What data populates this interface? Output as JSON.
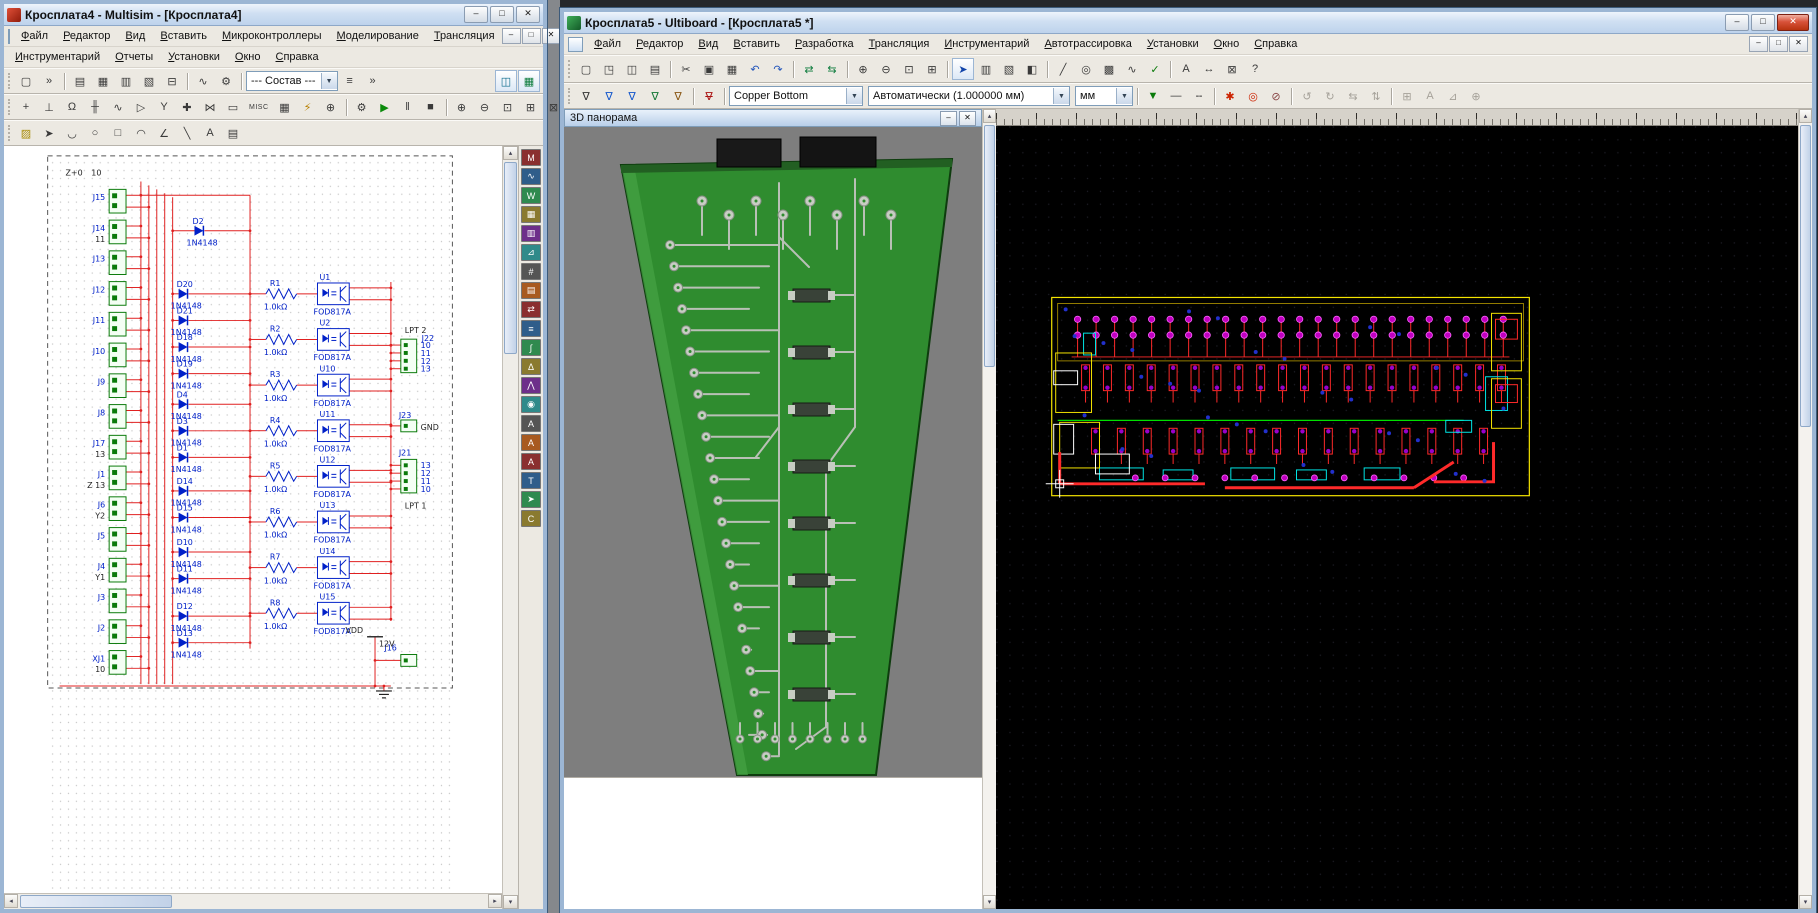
{
  "window_controls": {
    "minimize": "–",
    "maximize": "□",
    "close": "✕"
  },
  "multisim": {
    "title": "Кросплата4 - Multisim - [Кросплата4]",
    "menu_row1": [
      {
        "name": "file",
        "label": "Файл"
      },
      {
        "name": "edit",
        "label": "Редактор"
      },
      {
        "name": "view",
        "label": "Вид"
      },
      {
        "name": "place",
        "label": "Вставить"
      },
      {
        "name": "mcu",
        "label": "Микроконтроллеры"
      },
      {
        "name": "simulate",
        "label": "Моделирование"
      },
      {
        "name": "transfer",
        "label": "Трансляция"
      }
    ],
    "menu_row2": [
      {
        "name": "tools",
        "label": "Инструментарий"
      },
      {
        "name": "reports",
        "label": "Отчеты"
      },
      {
        "name": "options",
        "label": "Установки"
      },
      {
        "name": "window",
        "label": "Окно"
      },
      {
        "name": "help",
        "label": "Справка"
      }
    ],
    "composition_combo": "--- Состав ---",
    "toolbar_main_left": [
      {
        "name": "new-document-icon",
        "g": "▢"
      },
      {
        "name": "toolbar-overflow-icon",
        "g": "»"
      },
      {
        "sep": true
      },
      {
        "name": "component-database-icon",
        "g": "▤"
      },
      {
        "name": "spreadsheet-view-icon",
        "g": "▦"
      },
      {
        "name": "variants-icon",
        "g": "▥"
      },
      {
        "name": "sheet-properties-icon",
        "g": "▧"
      },
      {
        "name": "hierarchy-icon",
        "g": "⊟"
      },
      {
        "sep": true
      },
      {
        "name": "grapher-icon",
        "g": "∿"
      },
      {
        "name": "postprocessor-icon",
        "g": "⚙"
      },
      {
        "sep": true
      }
    ],
    "toolbar_main_right": [
      {
        "name": "list-view-icon",
        "g": "≡"
      },
      {
        "name": "overflow-icon",
        "g": "»"
      }
    ],
    "toolbar_main_far": [
      {
        "name": "capture-view-icon",
        "g": "◫",
        "c": "#0a6a8a",
        "cls": "raised"
      },
      {
        "name": "breadboard-view-icon",
        "g": "▦",
        "c": "#0a7a3a",
        "cls": "raised"
      }
    ],
    "toolbar_components": [
      {
        "name": "place-source-icon",
        "g": "+"
      },
      {
        "name": "place-ground-icon",
        "g": "⊥"
      },
      {
        "name": "place-resistor-icon",
        "g": "Ω"
      },
      {
        "name": "place-capacitor-icon",
        "g": "╫"
      },
      {
        "name": "place-inductor-icon",
        "g": "∿"
      },
      {
        "name": "place-diode-icon",
        "g": "▷"
      },
      {
        "name": "place-transistor-icon",
        "g": "Y"
      },
      {
        "name": "place-analog-icon",
        "g": "✚"
      },
      {
        "name": "place-ttl-icon",
        "g": "⋈"
      },
      {
        "name": "place-cmos-icon",
        "g": "▭"
      },
      {
        "name": "place-misc-icon",
        "g": "MISC",
        "cls": "wide"
      },
      {
        "name": "place-indicator-icon",
        "g": "▦"
      },
      {
        "name": "place-power-icon",
        "g": "⚡",
        "c": "#b88000"
      },
      {
        "name": "place-connector-icon",
        "g": "⊕"
      },
      {
        "sep": true
      },
      {
        "name": "simulation-settings-icon",
        "g": "⚙"
      },
      {
        "name": "run-simulation-icon",
        "g": "▶",
        "c": "#0a8a0a"
      },
      {
        "name": "pause-simulation-icon",
        "g": "‖"
      },
      {
        "name": "stop-simulation-icon",
        "g": "■"
      },
      {
        "sep": true
      },
      {
        "name": "zoom-in-icon",
        "g": "⊕"
      },
      {
        "name": "zoom-out-icon",
        "g": "⊖"
      },
      {
        "name": "zoom-area-icon",
        "g": "⊡"
      },
      {
        "name": "zoom-fit-icon",
        "g": "⊞"
      },
      {
        "name": "zoom-full-icon",
        "g": "⊠"
      }
    ],
    "toolbar_draw": [
      {
        "name": "in-use-list-icon",
        "g": "▨",
        "c": "#a88a00"
      },
      {
        "name": "select-tool-icon",
        "g": "➤"
      },
      {
        "name": "arc-tool-icon",
        "g": "◡"
      },
      {
        "name": "ellipse-tool-icon",
        "g": "○"
      },
      {
        "name": "rectangle-tool-icon",
        "g": "□"
      },
      {
        "name": "arc2-tool-icon",
        "g": "◠"
      },
      {
        "name": "polyline-tool-icon",
        "g": "∠"
      },
      {
        "name": "line-tool-icon",
        "g": "╲"
      },
      {
        "name": "text-tool-icon",
        "g": "A"
      },
      {
        "name": "comment-tool-icon",
        "g": "▤"
      }
    ],
    "instruments": [
      {
        "name": "multimeter-icon",
        "g": "M"
      },
      {
        "name": "function-generator-icon",
        "g": "∿"
      },
      {
        "name": "wattmeter-icon",
        "g": "W"
      },
      {
        "name": "oscilloscope-icon",
        "g": "▦"
      },
      {
        "name": "four-channel-oscilloscope-icon",
        "g": "▥"
      },
      {
        "name": "bode-plotter-icon",
        "g": "⊿"
      },
      {
        "name": "frequency-counter-icon",
        "g": "#"
      },
      {
        "name": "word-generator-icon",
        "g": "▤"
      },
      {
        "name": "logic-converter-icon",
        "g": "⇄"
      },
      {
        "name": "logic-analyzer-icon",
        "g": "≡"
      },
      {
        "name": "iv-analyzer-icon",
        "g": "∫"
      },
      {
        "name": "distortion-analyzer-icon",
        "g": "Δ"
      },
      {
        "name": "spectrum-analyzer-icon",
        "g": "⋀"
      },
      {
        "name": "network-analyzer-icon",
        "g": "◉"
      },
      {
        "name": "agilent-function-generator-icon",
        "g": "A"
      },
      {
        "name": "agilent-multimeter-icon",
        "g": "A"
      },
      {
        "name": "agilent-oscilloscope-icon",
        "g": "A"
      },
      {
        "name": "tektronix-oscilloscope-icon",
        "g": "T"
      },
      {
        "name": "measurement-probe-icon",
        "g": "➤"
      },
      {
        "name": "current-clamp-icon",
        "g": "C"
      }
    ],
    "schematic": {
      "origin_note": {
        "a": "Z+0",
        "b": "10"
      },
      "connectors": [
        {
          "label": "J15"
        },
        {
          "label": "J14",
          "sub": "11"
        },
        {
          "label": "J13"
        },
        {
          "label": "J12"
        },
        {
          "label": "J11"
        },
        {
          "label": "J10"
        },
        {
          "label": "J9"
        },
        {
          "label": "J8"
        },
        {
          "label": "J17",
          "sub": "13"
        },
        {
          "label": "J1",
          "sub": "Z 13"
        },
        {
          "label": "J6",
          "sub": "Y2"
        },
        {
          "label": "J5"
        },
        {
          "label": "J4",
          "sub": "Y1"
        },
        {
          "label": "J3"
        },
        {
          "label": "J2"
        },
        {
          "label": "XJ1",
          "sub": "10"
        }
      ],
      "diode_part": "1N4148",
      "diodes": [
        "D2",
        "D20",
        "D21",
        "D18",
        "D19",
        "D4",
        "D3",
        "D1",
        "D14",
        "D15",
        "D10",
        "D11",
        "D12",
        "D13"
      ],
      "resistor_value": "1.0kΩ",
      "opto_part": "FOD817A",
      "opto_rows": [
        {
          "r": "R1",
          "u": "U1"
        },
        {
          "r": "R2",
          "u": "U2"
        },
        {
          "r": "R3",
          "u": "U10"
        },
        {
          "r": "R4",
          "u": "U11"
        },
        {
          "r": "R5",
          "u": "U12"
        },
        {
          "r": "R6",
          "u": "U13"
        },
        {
          "r": "R7",
          "u": "U14"
        },
        {
          "r": "R8",
          "u": "U15"
        }
      ],
      "lpt2": {
        "label": "LPT 2",
        "conn": "J22",
        "pins": [
          "10",
          "11",
          "12",
          "13"
        ]
      },
      "gnd": {
        "conn": "J23",
        "label": "GND"
      },
      "lpt1": {
        "label": "LPT 1",
        "conn": "J21",
        "pins": [
          "13",
          "12",
          "11",
          "10"
        ]
      },
      "bottom_conn": "J16",
      "power": {
        "label": "VDD",
        "value": "12V"
      }
    }
  },
  "ultiboard": {
    "title": "Кросплата5 - Ultiboard - [Кросплата5 *]",
    "menu": [
      {
        "name": "file",
        "label": "Файл"
      },
      {
        "name": "edit",
        "label": "Редактор"
      },
      {
        "name": "view",
        "label": "Вид"
      },
      {
        "name": "place",
        "label": "Вставить"
      },
      {
        "name": "design",
        "label": "Разработка"
      },
      {
        "name": "transfer",
        "label": "Трансляция"
      },
      {
        "name": "tools",
        "label": "Инструментарий"
      },
      {
        "name": "autoroute",
        "label": "Автотрассировка"
      },
      {
        "name": "options",
        "label": "Установки"
      },
      {
        "name": "window",
        "label": "Окно"
      },
      {
        "name": "help",
        "label": "Справка"
      }
    ],
    "panel_3d_title": "3D панорама",
    "layer_combo": "Copper Bottom",
    "grid_combo": "Автоматически (1.000000 мм)",
    "units_combo": "мм",
    "toolbar_std": [
      {
        "name": "new-file-icon",
        "g": "▢"
      },
      {
        "name": "open-file-icon",
        "g": "◳"
      },
      {
        "name": "save-file-icon",
        "g": "◫"
      },
      {
        "name": "print-icon",
        "g": "▤"
      },
      {
        "sep": true
      },
      {
        "name": "cut-icon",
        "g": "✂"
      },
      {
        "name": "copy-icon",
        "g": "▣"
      },
      {
        "name": "paste-icon",
        "g": "▦"
      },
      {
        "name": "undo-icon",
        "g": "↶",
        "c": "#2255bb"
      },
      {
        "name": "redo-icon",
        "g": "↷",
        "c": "#2255bb"
      },
      {
        "sep": true
      },
      {
        "name": "forward-annotate-icon",
        "g": "⇄",
        "c": "#0a7a3a"
      },
      {
        "name": "backward-annotate-icon",
        "g": "⇆",
        "c": "#0a7a3a"
      },
      {
        "sep": true
      },
      {
        "name": "zoom-in-icon",
        "g": "⊕"
      },
      {
        "name": "zoom-out-icon",
        "g": "⊖"
      },
      {
        "name": "zoom-window-icon",
        "g": "⊡"
      },
      {
        "name": "zoom-fit-icon",
        "g": "⊞"
      },
      {
        "sep": true
      },
      {
        "name": "select-tool-icon",
        "g": "➤",
        "cls": "raised",
        "c": "#1144aa"
      },
      {
        "name": "spreadsheet-view-icon",
        "g": "▥"
      },
      {
        "name": "database-icon",
        "g": "▧"
      },
      {
        "name": "layers-icon",
        "g": "◧"
      },
      {
        "sep": true
      },
      {
        "name": "place-line-icon",
        "g": "╱"
      },
      {
        "name": "place-via-icon",
        "g": "◎"
      },
      {
        "name": "copper-area-icon",
        "g": "▩"
      },
      {
        "name": "ratsnest-icon",
        "g": "∿"
      },
      {
        "name": "drc-check-icon",
        "g": "✓",
        "c": "#0a7a0a"
      },
      {
        "sep": true
      },
      {
        "name": "text-tool-icon",
        "g": "A"
      },
      {
        "name": "dimension-icon",
        "g": "↔"
      },
      {
        "name": "select-area-icon",
        "g": "⊠"
      },
      {
        "name": "help-icon",
        "g": "?"
      }
    ],
    "toolbar_filter_left": [
      {
        "name": "filter-show-all-icon",
        "g": "∇",
        "c": "#333333"
      },
      {
        "name": "filter-parts-icon",
        "g": "∇",
        "c": "#1155cc"
      },
      {
        "name": "filter-traces-icon",
        "g": "∇",
        "c": "#1155cc"
      },
      {
        "name": "filter-vias-icon",
        "g": "∇",
        "c": "#117733"
      },
      {
        "name": "filter-copper-icon",
        "g": "∇",
        "c": "#885511"
      },
      {
        "sep": true
      },
      {
        "name": "filter-off-icon",
        "g": "∇",
        "c": "#aa1111",
        "cls": "xed"
      },
      {
        "sep": true
      }
    ],
    "toolbar_filter_right": [
      {
        "name": "color-picker-icon",
        "g": "▼",
        "c": "#0a7a0a"
      },
      {
        "name": "line-width-icon",
        "g": "—"
      },
      {
        "name": "line-style-icon",
        "g": "╌"
      },
      {
        "sep": true
      },
      {
        "name": "polygon-tool-icon",
        "g": "✱",
        "c": "#cc2200"
      },
      {
        "name": "via-tool-icon",
        "g": "◎",
        "c": "#cc2200"
      },
      {
        "name": "edit-lock-icon",
        "g": "⊘",
        "c": "#884444"
      },
      {
        "sep": true
      },
      {
        "name": "rotate-ccw-icon",
        "g": "↺",
        "cls": "dis"
      },
      {
        "name": "rotate-cw-icon",
        "g": "↻",
        "cls": "dis"
      },
      {
        "name": "flip-horizontal-icon",
        "g": "⇆",
        "cls": "dis"
      },
      {
        "name": "flip-vertical-icon",
        "g": "⇅",
        "cls": "dis"
      },
      {
        "sep": true
      },
      {
        "name": "shove-parts-icon",
        "g": "⊞",
        "cls": "dis"
      },
      {
        "name": "text-size-icon",
        "g": "A",
        "cls": "dis"
      },
      {
        "name": "angle-snap-icon",
        "g": "⊿",
        "cls": "dis"
      },
      {
        "name": "origin-icon",
        "g": "⊕",
        "cls": "dis"
      }
    ]
  }
}
